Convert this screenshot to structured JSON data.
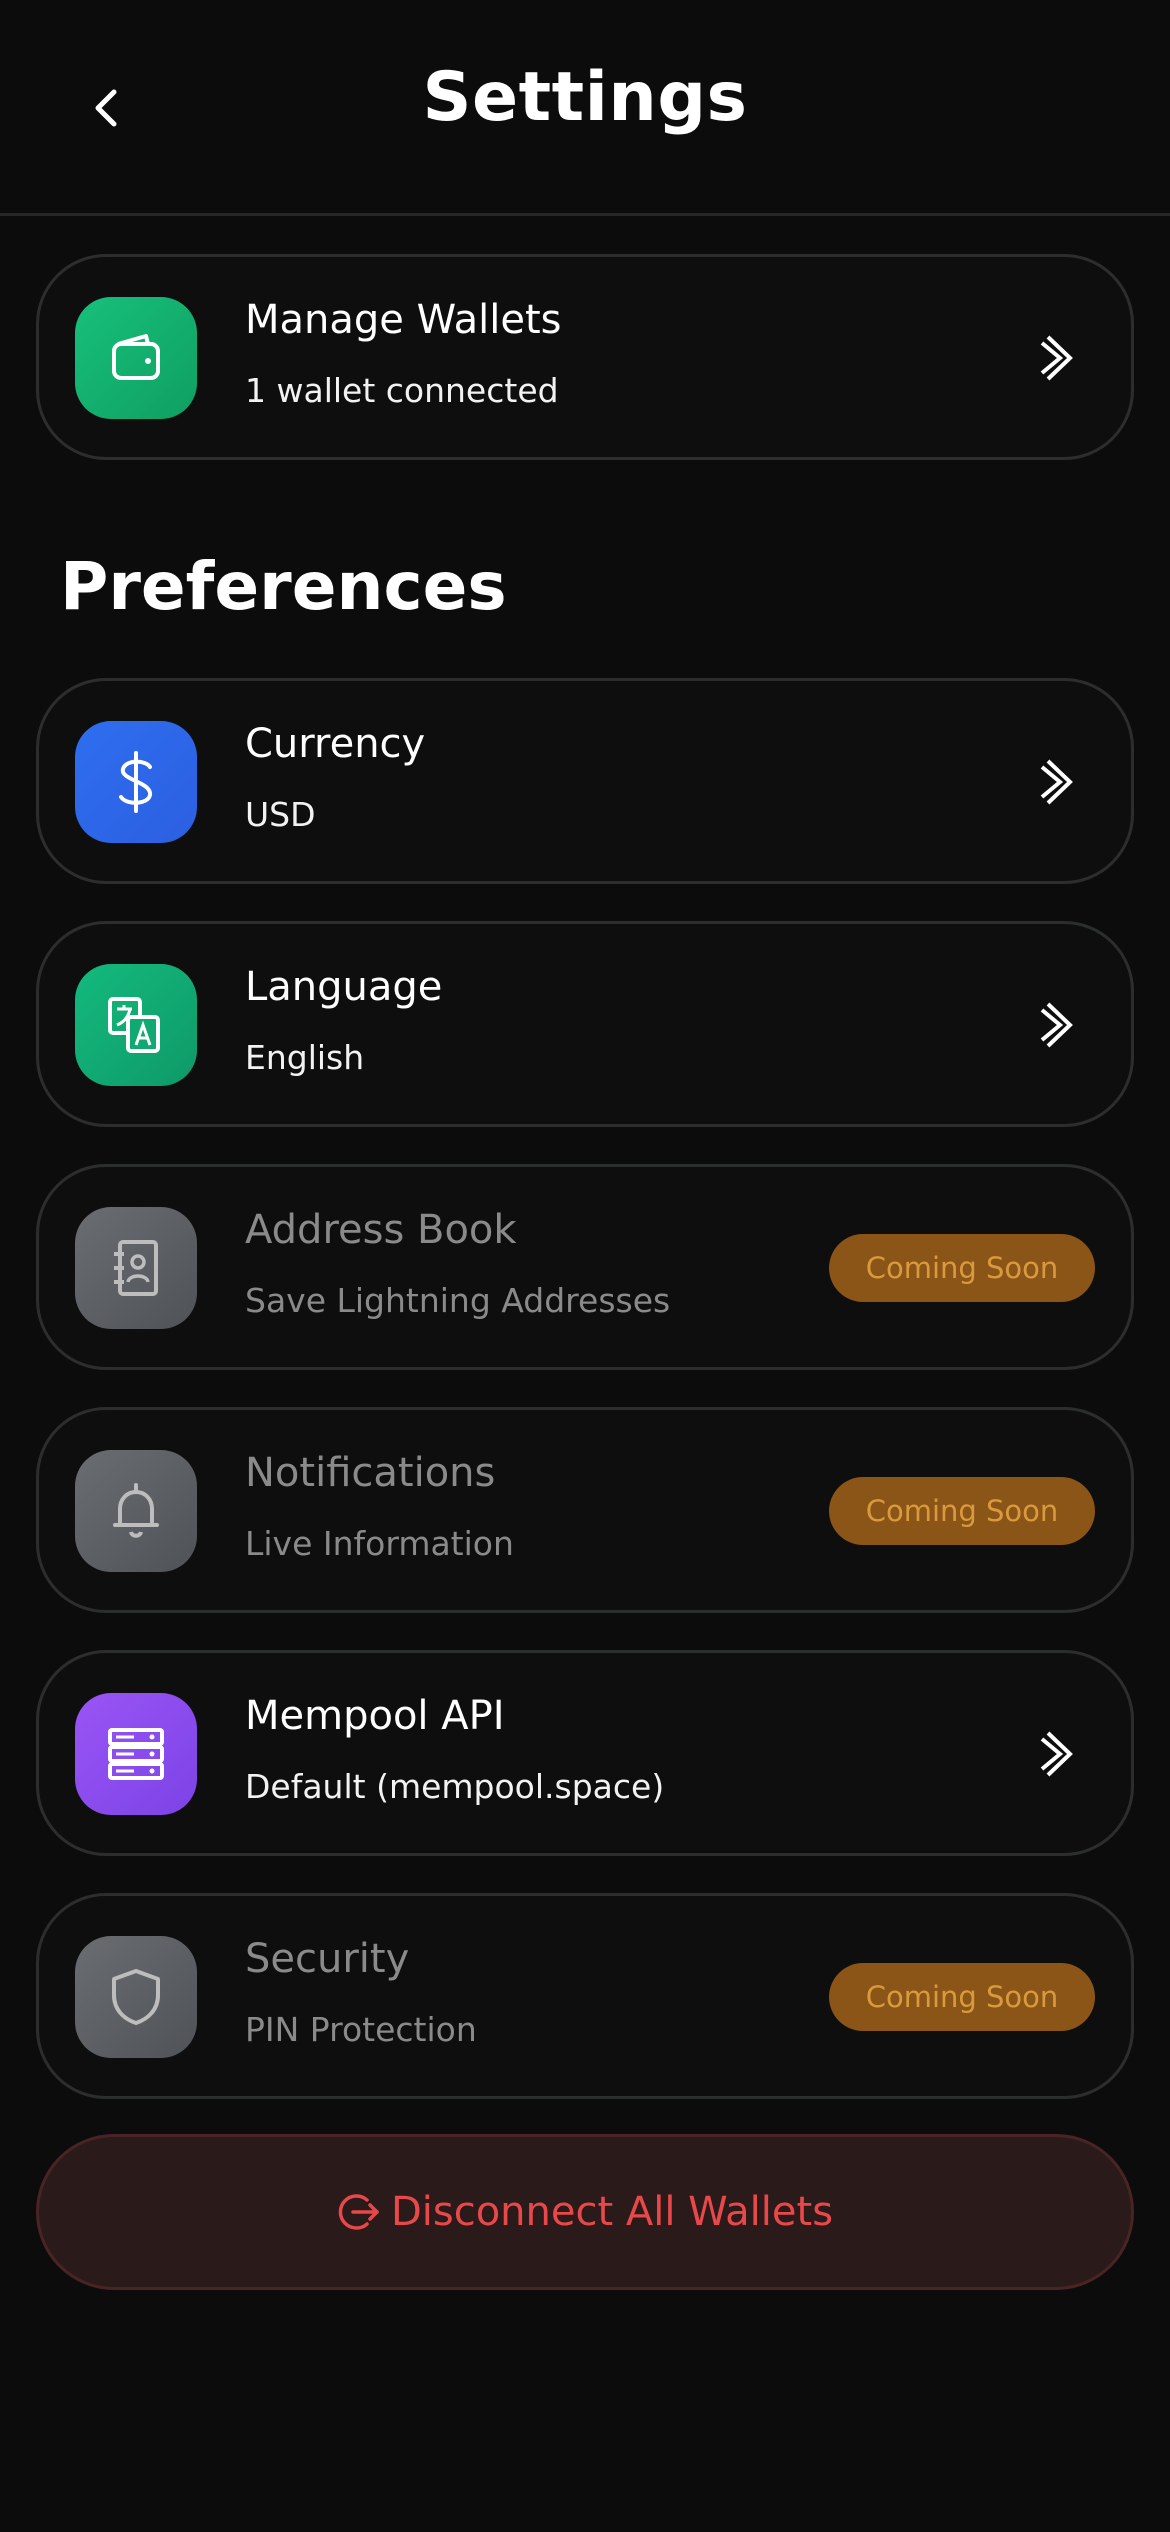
{
  "header": {
    "title": "Settings",
    "back_icon": "chevron-left-icon"
  },
  "wallets_card": {
    "title": "Manage Wallets",
    "subtitle": "1 wallet connected",
    "icon": "wallet-icon",
    "icon_color": "#17c07a"
  },
  "preferences": {
    "section_title": "Preferences",
    "items": [
      {
        "title": "Currency",
        "subtitle": "USD",
        "icon": "dollar-icon",
        "icon_color": "#2f6ef0",
        "enabled": true
      },
      {
        "title": "Language",
        "subtitle": "English",
        "icon": "translate-icon",
        "icon_color": "#12b07a",
        "enabled": true
      },
      {
        "title": "Address Book",
        "subtitle": "Save Lightning Addresses",
        "icon": "contact-book-icon",
        "icon_color": "#5a5d62",
        "enabled": false,
        "badge": "Coming Soon"
      },
      {
        "title": "Notifications",
        "subtitle": "Live Information",
        "icon": "bell-icon",
        "icon_color": "#5a5d62",
        "enabled": false,
        "badge": "Coming Soon"
      },
      {
        "title": "Mempool API",
        "subtitle": "Default (mempool.space)",
        "icon": "server-icon",
        "icon_color": "#8b4ff0",
        "enabled": true
      },
      {
        "title": "Security",
        "subtitle": "PIN Protection",
        "icon": "shield-icon",
        "icon_color": "#5a5d62",
        "enabled": false,
        "badge": "Coming Soon"
      }
    ]
  },
  "disconnect_button": {
    "label": "Disconnect All Wallets",
    "icon": "logout-icon",
    "color": "#e8484a"
  },
  "colors": {
    "background": "#0c0c0c",
    "card_border": "#2b2e2c",
    "badge_bg": "#8a5517",
    "badge_text": "#d99a3e"
  }
}
